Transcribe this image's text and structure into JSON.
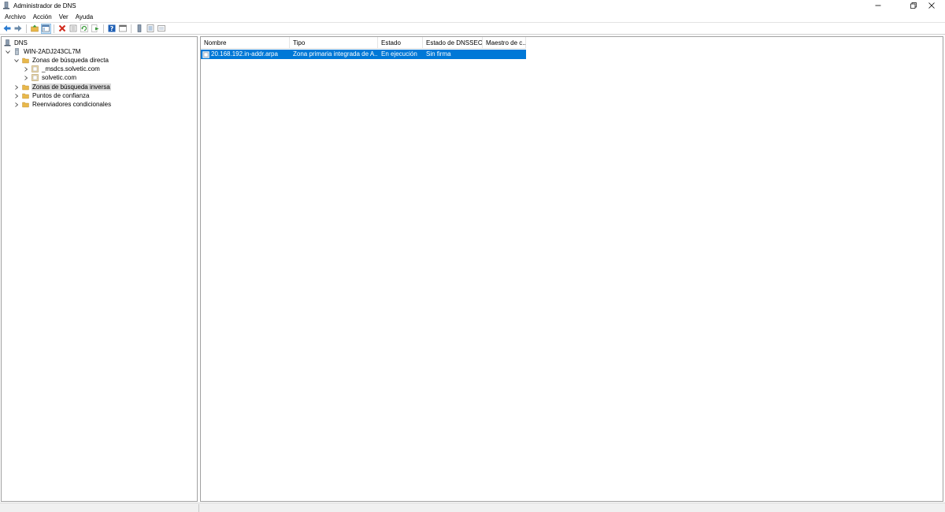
{
  "window": {
    "title": "Administrador de DNS",
    "icons": {
      "app": "dns-manager-icon",
      "minimize": "minimize-icon",
      "restore": "restore-icon",
      "close": "close-icon"
    }
  },
  "menu": {
    "items": [
      "Archivo",
      "Acción",
      "Ver",
      "Ayuda"
    ]
  },
  "toolbar": {
    "buttons": [
      "back-icon",
      "forward-icon",
      "up-folder-icon",
      "show-hide-console-tree-icon",
      "delete-icon",
      "properties-icon",
      "refresh-icon",
      "export-list-icon",
      "help-icon",
      "console-view-icon",
      "server-icon",
      "list-view-icon",
      "zone-view-icon"
    ]
  },
  "tree": {
    "root": "DNS",
    "server": "WIN-2ADJ243CL7M",
    "forward_zones": "Zonas de búsqueda directa",
    "zone_msdcs": "_msdcs.solvetic.com",
    "zone_solvetic": "solvetic.com",
    "reverse_zones": "Zonas de búsqueda inversa",
    "trust_points": "Puntos de confianza",
    "conditional_forwarders": "Reenviadores condicionales"
  },
  "list": {
    "columns": [
      "Nombre",
      "Tipo",
      "Estado",
      "Estado de DNSSEC",
      "Maestro de c..."
    ],
    "rows": [
      {
        "name": "20.168.192.in-addr.arpa",
        "type": "Zona primaria integrada de A...",
        "status": "En ejecución",
        "dnssec": "Sin firma",
        "master": ""
      }
    ]
  },
  "colors": {
    "selection": "#0078d7",
    "tree_selection": "#d9d9d9",
    "folder": "#e8b84b"
  }
}
